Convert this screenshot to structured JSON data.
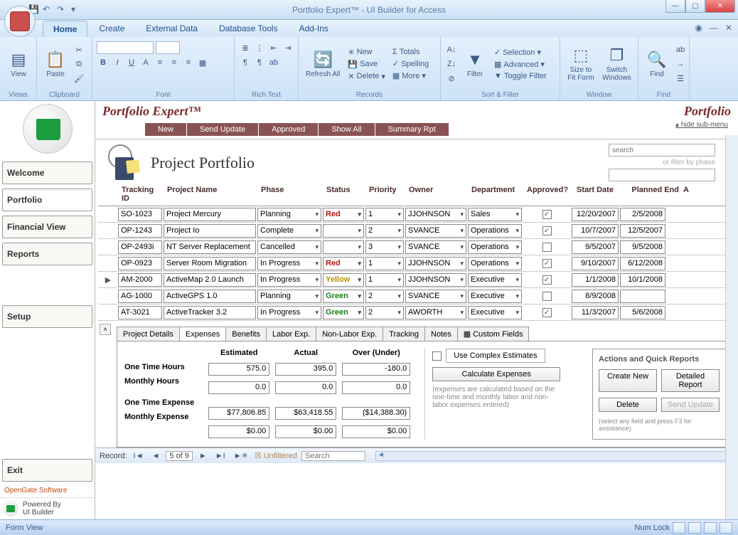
{
  "window": {
    "title": "Portfolio Expert™ - UI Builder for Access"
  },
  "ribbon": {
    "tabs": [
      "Home",
      "Create",
      "External Data",
      "Database Tools",
      "Add-Ins"
    ],
    "active": "Home",
    "groups": {
      "views": {
        "label": "Views",
        "view": "View"
      },
      "clipboard": {
        "label": "Clipboard",
        "paste": "Paste"
      },
      "font": {
        "label": "Font"
      },
      "richtext": {
        "label": "Rich Text"
      },
      "records": {
        "label": "Records",
        "refresh": "Refresh All",
        "new": "New",
        "save": "Save",
        "delete": "Delete",
        "totals": "Totals",
        "spelling": "Spelling",
        "more": "More"
      },
      "sortfilter": {
        "label": "Sort & Filter",
        "filter": "Filter",
        "selection": "Selection",
        "advanced": "Advanced",
        "toggle": "Toggle Filter"
      },
      "window": {
        "label": "Window",
        "size": "Size to Fit Form",
        "switch": "Switch Windows"
      },
      "find": {
        "label": "Find",
        "find": "Find"
      }
    }
  },
  "leftnav": {
    "items": [
      "Welcome",
      "Portfolio",
      "Financial View",
      "Reports",
      "Setup",
      "Exit"
    ],
    "active": "Portfolio",
    "vendor": "OpenGate Software",
    "powered1": "Powered By",
    "powered2": "UI Builder"
  },
  "page": {
    "brand_left": "Portfolio Expert™",
    "brand_right": "Portfolio",
    "brown_tabs": [
      "New",
      "Send Update",
      "Approved",
      "Show All",
      "Summary Rpt"
    ],
    "hide": "hide sub-menu",
    "title": "Project Portfolio",
    "search_placeholder": "search",
    "filter_placeholder": "or filter by phase"
  },
  "grid": {
    "headers": {
      "tracking": "Tracking ID",
      "project": "Project Name",
      "phase": "Phase",
      "status": "Status",
      "priority": "Priority",
      "owner": "Owner",
      "department": "Department",
      "approved": "Approved?",
      "start": "Start Date",
      "end": "Planned End",
      "a": "A"
    },
    "rows": [
      {
        "tracking": "SO-1023",
        "project": "Project Mercury",
        "phase": "Planning",
        "status": "Red",
        "status_cls": "red",
        "priority": "1",
        "owner": "JJOHNSON",
        "dept": "Sales",
        "approved": true,
        "start": "12/20/2007",
        "end": "2/5/2008",
        "marker": ""
      },
      {
        "tracking": "OP-1243",
        "project": "Project Io",
        "phase": "Complete",
        "status": "",
        "status_cls": "",
        "priority": "2",
        "owner": "SVANCE",
        "dept": "Operations",
        "approved": true,
        "start": "10/7/2007",
        "end": "12/5/2007",
        "marker": ""
      },
      {
        "tracking": "OP-2493i",
        "project": "NT Server Replacement",
        "phase": "Cancelled",
        "status": "",
        "status_cls": "",
        "priority": "3",
        "owner": "SVANCE",
        "dept": "Operations",
        "approved": false,
        "start": "9/5/2007",
        "end": "9/5/2008",
        "marker": ""
      },
      {
        "tracking": "OP-0923",
        "project": "Server Room Migration",
        "phase": "In Progress",
        "status": "Red",
        "status_cls": "red",
        "priority": "1",
        "owner": "JJOHNSON",
        "dept": "Operations",
        "approved": true,
        "start": "9/10/2007",
        "end": "6/12/2008",
        "marker": ""
      },
      {
        "tracking": "AM-2000",
        "project": "ActiveMap 2.0 Launch",
        "phase": "In Progress",
        "status": "Yellow",
        "status_cls": "yellow",
        "priority": "1",
        "owner": "JJOHNSON",
        "dept": "Executive",
        "approved": true,
        "start": "1/1/2008",
        "end": "10/1/2008",
        "marker": "▶"
      },
      {
        "tracking": "AG-1000",
        "project": "ActiveGPS 1.0",
        "phase": "Planning",
        "status": "Green",
        "status_cls": "green",
        "priority": "2",
        "owner": "SVANCE",
        "dept": "Executive",
        "approved": false,
        "start": "8/9/2008",
        "end": "",
        "marker": ""
      },
      {
        "tracking": "AT-3021",
        "project": "ActiveTracker 3.2",
        "phase": "In Progress",
        "status": "Green",
        "status_cls": "green",
        "priority": "2",
        "owner": "AWORTH",
        "dept": "Executive",
        "approved": true,
        "start": "11/3/2007",
        "end": "5/6/2008",
        "marker": ""
      }
    ]
  },
  "detail": {
    "tabs": [
      "Project Details",
      "Expenses",
      "Benefits",
      "Labor Exp.",
      "Non-Labor Exp.",
      "Tracking",
      "Notes",
      "Custom Fields"
    ],
    "active": "Expenses",
    "exp": {
      "col_headers": [
        "Estimated",
        "Actual",
        "Over (Under)"
      ],
      "row_labels": [
        "One Time Hours",
        "Monthly Hours",
        "One Time Expense",
        "Monthly Expense"
      ],
      "vals": {
        "oth": [
          "575.0",
          "395.0",
          "-180.0"
        ],
        "mh": [
          "0.0",
          "0.0",
          "0.0"
        ],
        "ote": [
          "$77,806.85",
          "$63,418.55",
          "($14,388.30)"
        ],
        "me": [
          "$0.00",
          "$0.00",
          "$0.00"
        ]
      },
      "complex": "Use Complex Estimates",
      "calc": "Calculate Expenses",
      "note": "(expenses are calculated based on the one-time and monthly labor and non-labor expenses entered)"
    },
    "actions": {
      "title": "Actions and Quick Reports",
      "create": "Create New",
      "detail": "Detailed Report",
      "delete": "Delete",
      "send": "Send Update",
      "hint": "(select any field and press F3 for assistance)"
    }
  },
  "recordnav": {
    "label": "Record:",
    "pos": "5 of 9",
    "filter": "Unfiltered",
    "search": "Search"
  },
  "statusbar": {
    "left": "Form View",
    "right": "Num Lock"
  }
}
